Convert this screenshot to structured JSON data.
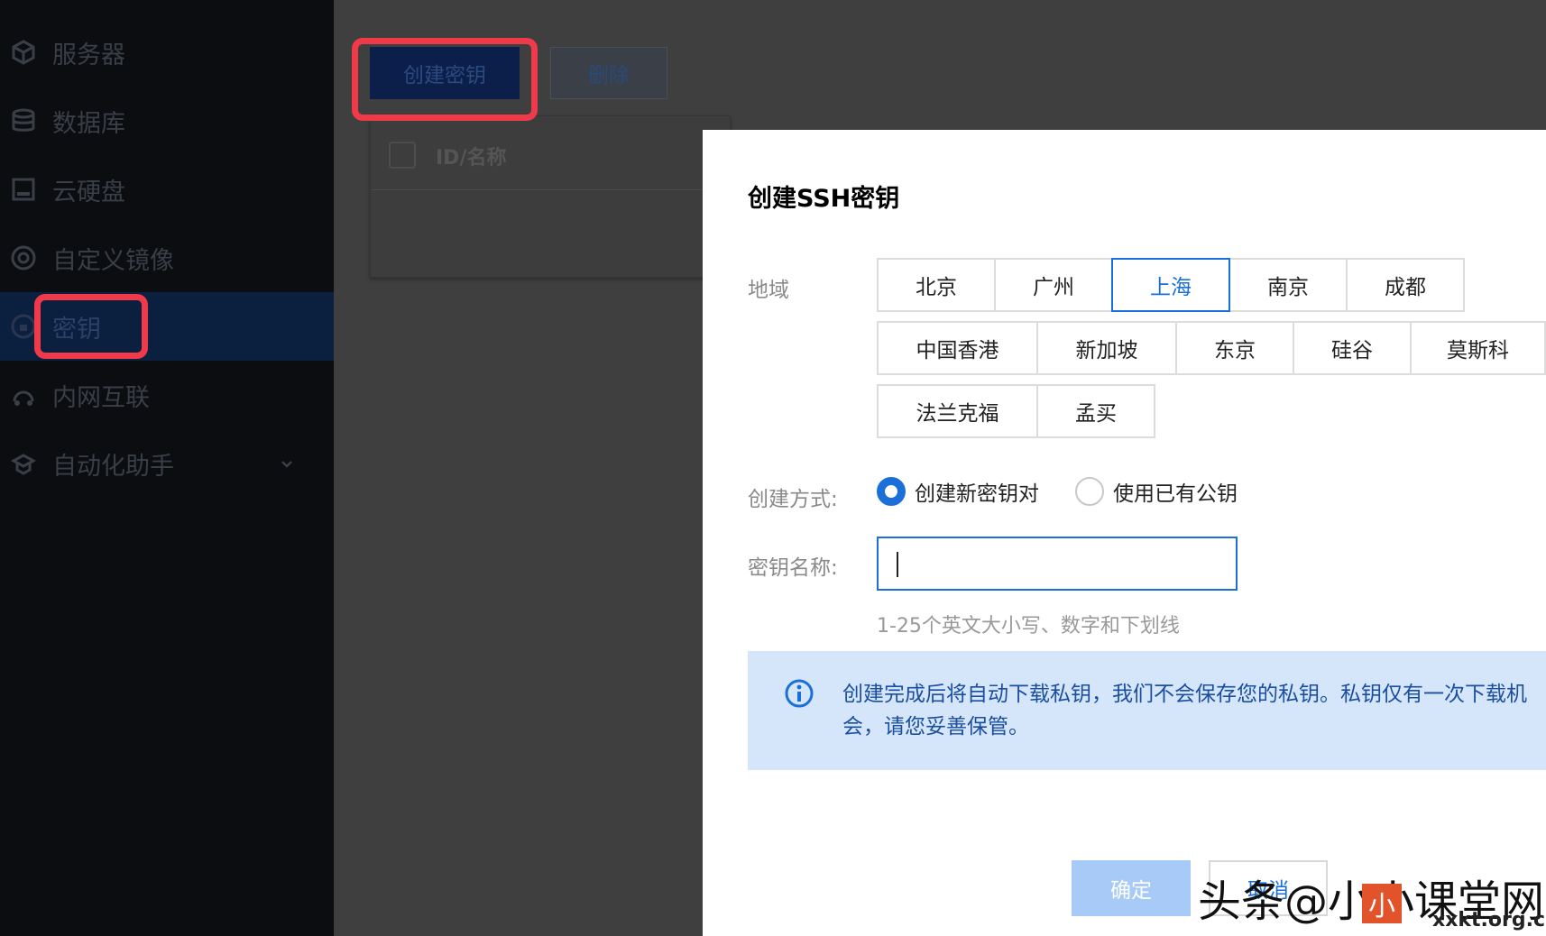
{
  "sidebar": {
    "items": [
      {
        "label": "服务器",
        "icon": "cube-icon"
      },
      {
        "label": "数据库",
        "icon": "database-icon"
      },
      {
        "label": "云硬盘",
        "icon": "disk-icon"
      },
      {
        "label": "自定义镜像",
        "icon": "image-icon"
      },
      {
        "label": "密钥",
        "icon": "key-lock-icon",
        "active": true
      },
      {
        "label": "内网互联",
        "icon": "network-icon"
      },
      {
        "label": "自动化助手",
        "icon": "assistant-icon",
        "expandable": true
      }
    ]
  },
  "toolbar": {
    "create_label": "创建密钥",
    "delete_label": "删除"
  },
  "table": {
    "columns": [
      "ID/名称"
    ]
  },
  "modal": {
    "title": "创建SSH密钥",
    "region_label": "地域",
    "regions": [
      {
        "name": "北京"
      },
      {
        "name": "广州"
      },
      {
        "name": "上海",
        "selected": true
      },
      {
        "name": "南京"
      },
      {
        "name": "成都"
      },
      {
        "name": "中国香港"
      },
      {
        "name": "新加坡"
      },
      {
        "name": "东京"
      },
      {
        "name": "硅谷"
      },
      {
        "name": "莫斯科"
      },
      {
        "name": "法兰克福"
      },
      {
        "name": "孟买"
      }
    ],
    "method_label": "创建方式:",
    "methods": [
      {
        "label": "创建新密钥对",
        "checked": true
      },
      {
        "label": "使用已有公钥",
        "checked": false
      }
    ],
    "name_label": "密钥名称:",
    "name_value": "",
    "name_hint": "1-25个英文大小写、数字和下划线",
    "notice_line1": "创建完成后将自动下载私钥，我们不会保存您的私钥。私钥仅有一次下载机",
    "notice_line2": "会，请您妥善保管。",
    "ok_label": "确定",
    "cancel_label": "取消"
  },
  "watermark": {
    "text": "头条@小小课堂网",
    "site_badge": "小",
    "site_url": "xxkt.org.cn"
  },
  "colors": {
    "accent": "#1a6fd8",
    "highlight": "#f03a4a",
    "notice_bg": "#d6e6fa"
  }
}
